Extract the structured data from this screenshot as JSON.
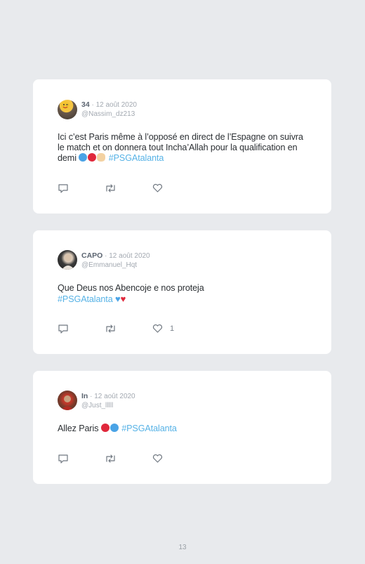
{
  "tweets": [
    {
      "name": "34",
      "date": "12 août 2020",
      "handle": "@Nassim_dz213",
      "text": "Ici c’est Paris même à l’opposé en direct de l’Espagne on suivra le match et on donnera tout Incha’Allah pour la qualification en demi",
      "hashtag": "#PSGAtalanta",
      "likes": ""
    },
    {
      "name": "CAPO",
      "date": "12 août 2020",
      "handle": "@Emmanuel_Hqt",
      "text": "Que Deus nos Abencoje e nos proteja",
      "hashtag": "#PSGAtalanta",
      "likes": "1"
    },
    {
      "name": "In",
      "date": "12 août 2020",
      "handle": "@Just_lllll",
      "text": "Allez Paris",
      "hashtag": "#PSGAtalanta",
      "likes": ""
    }
  ],
  "separator": " · ",
  "page_number": "13",
  "colors": {
    "hashtag": "#56b2e6",
    "blue_heart": "#4aa3e6",
    "red_heart": "#e0283b"
  }
}
